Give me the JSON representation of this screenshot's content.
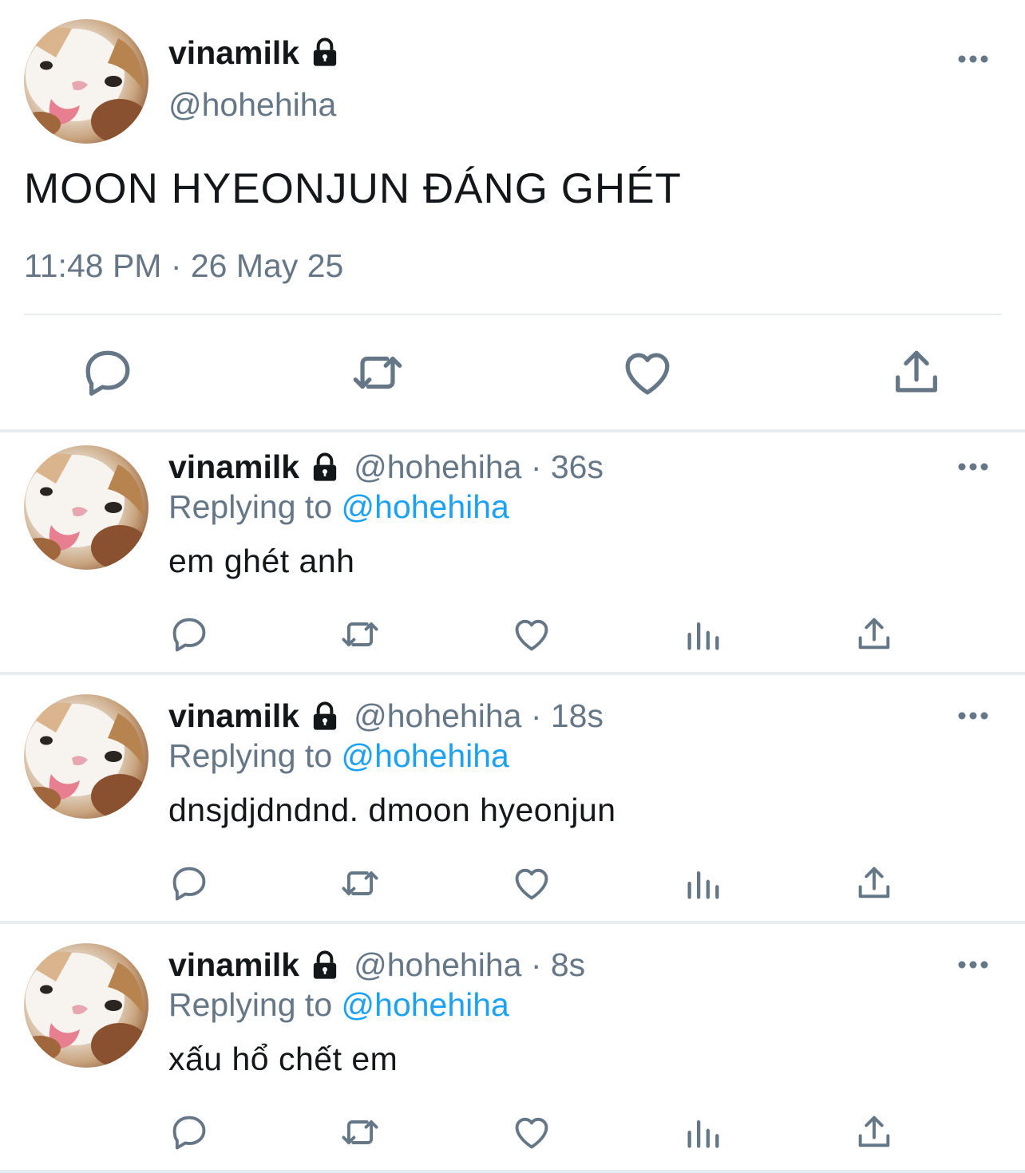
{
  "main_tweet": {
    "name": "vinamilk",
    "handle": "@hohehiha",
    "text": "MOON HYEONJUN ĐÁNG GHÉT",
    "timestamp": "11:48 PM · 26 May 25",
    "icons": [
      "lock-icon",
      "more-icon",
      "reply-icon",
      "retweet-icon",
      "like-icon",
      "share-icon"
    ]
  },
  "replies": [
    {
      "name": "vinamilk",
      "handle_time": "@hohehiha · 36s",
      "replying_prefix": "Replying to ",
      "replying_mention": "@hohehiha",
      "text": "em ghét anh"
    },
    {
      "name": "vinamilk",
      "handle_time": "@hohehiha · 18s",
      "replying_prefix": "Replying to ",
      "replying_mention": "@hohehiha",
      "text": "dnsjdjdndnd. dmoon hyeonjun"
    },
    {
      "name": "vinamilk",
      "handle_time": "@hohehiha · 8s",
      "replying_prefix": "Replying to ",
      "replying_mention": "@hohehiha",
      "text": "xấu hổ chết em"
    }
  ],
  "colors": {
    "text": "#14171a",
    "secondary": "#657786",
    "link": "#1da1f2",
    "divider": "#e6ecf0"
  }
}
